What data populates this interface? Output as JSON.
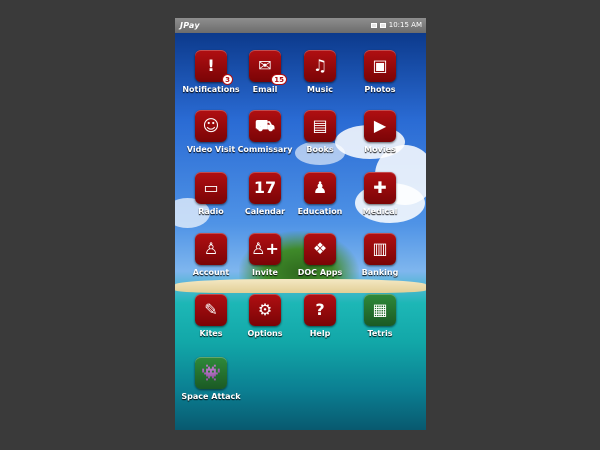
{
  "status_bar": {
    "logo": "JPay",
    "time": "10:15 AM",
    "icons": [
      "sim-card-icon",
      "battery-icon"
    ]
  },
  "apps": [
    {
      "label": "Notifications",
      "icon": "exclamation-icon",
      "glyph": "!",
      "badge": "3"
    },
    {
      "label": "Email",
      "icon": "envelope-icon",
      "glyph": "✉",
      "badge": "15"
    },
    {
      "label": "Music",
      "icon": "music-note-icon",
      "glyph": "♫",
      "badge": ""
    },
    {
      "label": "Photos",
      "icon": "picture-icon",
      "glyph": "▣",
      "badge": ""
    },
    {
      "label": "Video Visit",
      "icon": "video-visit-icon",
      "glyph": "☺",
      "badge": ""
    },
    {
      "label": "Commissary",
      "icon": "shopping-cart-icon",
      "glyph": "⛟",
      "badge": ""
    },
    {
      "label": "Books",
      "icon": "book-icon",
      "glyph": "▤",
      "badge": ""
    },
    {
      "label": "Movies",
      "icon": "video-camera-icon",
      "glyph": "▶",
      "badge": ""
    },
    {
      "label": "Radio",
      "icon": "radio-icon",
      "glyph": "▭",
      "badge": ""
    },
    {
      "label": "Calendar",
      "icon": "calendar-icon",
      "glyph": "17",
      "badge": ""
    },
    {
      "label": "Education",
      "icon": "graduate-icon",
      "glyph": "♟",
      "badge": ""
    },
    {
      "label": "Medical",
      "icon": "medical-cross-icon",
      "glyph": "✚",
      "badge": ""
    },
    {
      "label": "Account",
      "icon": "user-icon",
      "glyph": "♙",
      "badge": ""
    },
    {
      "label": "Invite",
      "icon": "add-user-icon",
      "glyph": "♙+",
      "badge": ""
    },
    {
      "label": "DOC Apps",
      "icon": "doc-apps-icon",
      "glyph": "❖",
      "badge": ""
    },
    {
      "label": "Banking",
      "icon": "bank-icon",
      "glyph": "▥",
      "badge": ""
    },
    {
      "label": "Kites",
      "icon": "kite-icon",
      "glyph": "✎",
      "badge": ""
    },
    {
      "label": "Options",
      "icon": "gears-icon",
      "glyph": "⚙",
      "badge": ""
    },
    {
      "label": "Help",
      "icon": "question-mark-icon",
      "glyph": "?",
      "badge": ""
    },
    {
      "label": "Tetris",
      "icon": "tetris-blocks-icon",
      "glyph": "▦",
      "badge": "",
      "color": "#2f8a3a"
    },
    {
      "label": "Space Attack",
      "icon": "space-invader-icon",
      "glyph": "👾",
      "badge": "",
      "color": "#2f8a3a"
    }
  ],
  "colors": {
    "app_icon_red": "#b10f12",
    "game_icon_green": "#2f8a3a",
    "status_bar_gray": "#7a7a7a"
  }
}
